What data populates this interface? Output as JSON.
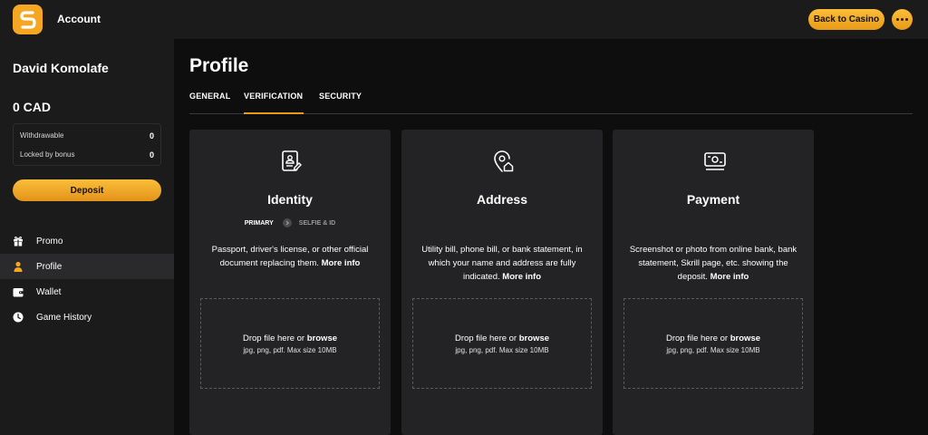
{
  "header": {
    "title": "Account",
    "back_label": "Back to Casino",
    "brand_color": "#f5a623"
  },
  "sidebar": {
    "user_name": "David Komolafe",
    "balance": "0 CAD",
    "withdrawable_label": "Withdrawable",
    "withdrawable_value": "0",
    "locked_label": "Locked by bonus",
    "locked_value": "0",
    "deposit_label": "Deposit",
    "items": [
      {
        "label": "Promo",
        "icon": "gift-icon"
      },
      {
        "label": "Profile",
        "icon": "user-icon",
        "active": true
      },
      {
        "label": "Wallet",
        "icon": "wallet-icon"
      },
      {
        "label": "Game History",
        "icon": "clock-icon"
      }
    ]
  },
  "main": {
    "title": "Profile",
    "tabs": [
      {
        "label": "GENERAL"
      },
      {
        "label": "VERIFICATION",
        "active": true
      },
      {
        "label": "SECURITY"
      }
    ],
    "cards": [
      {
        "title": "Identity",
        "icon": "id-document-icon",
        "step_primary": "PRIMARY",
        "step_secondary": "SELFIE & ID",
        "desc": "Passport, driver's license, or other official document replacing them.",
        "more": "More info"
      },
      {
        "title": "Address",
        "icon": "location-home-icon",
        "desc": "Utility bill, phone bill, or bank statement, in which your name and address are fully indicated.",
        "more": "More info"
      },
      {
        "title": "Payment",
        "icon": "payment-icon",
        "desc": "Screenshot or photo from online bank, bank statement, Skrill page, etc. showing the deposit.",
        "more": "More info"
      }
    ],
    "dropzone": {
      "text": "Drop file here or",
      "browse": "browse",
      "hint": "jpg, png, pdf. Max size 10MB"
    }
  }
}
